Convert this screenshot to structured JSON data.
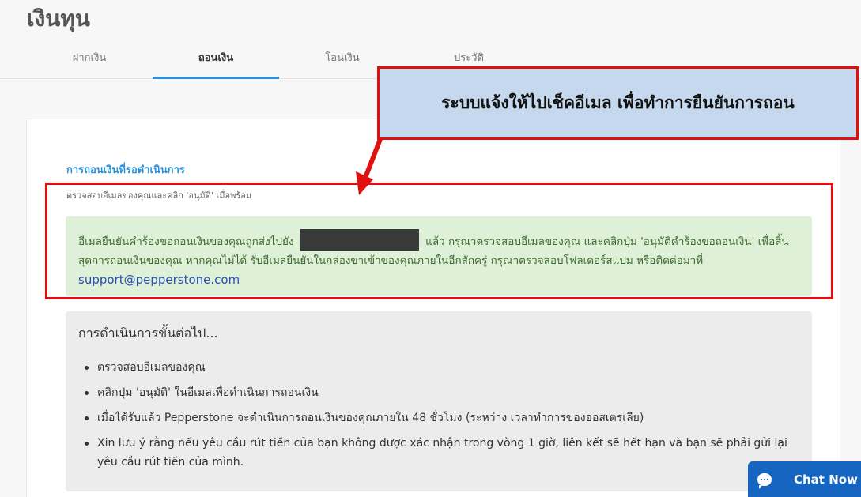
{
  "page": {
    "title": "เงินทุน"
  },
  "tabs": [
    {
      "label": "ฝากเงิน",
      "active": false
    },
    {
      "label": "ถอนเงิน",
      "active": true
    },
    {
      "label": "โอนเงิน",
      "active": false
    },
    {
      "label": "ประวัติ",
      "active": false
    }
  ],
  "pending": {
    "title": "การถอนเงินที่รอดำเนินการ",
    "subtitle": "ตรวจสอบอีเมลของคุณและคลิก 'อนุมัติ' เมื่อพร้อม"
  },
  "alert": {
    "text_before": "อีเมลยืนยันคำร้องขอถอนเงินของคุณถูกส่งไปยัง",
    "text_after": "แล้ว กรุณาตรวจสอบอีเมลของคุณ และคลิกปุ่ม 'อนุมัติคำร้องขอถอนเงิน' เพื่อสิ้นสุดการถอนเงินของคุณ หากคุณไม่ได้ รับอีเมลยืนยันในกล่องขาเข้าของคุณภายในอีกสักครู่ กรุณาตรวจสอบโฟลเดอร์สแปม หรือติดต่อมาที่",
    "email": "support@pepperstone.com"
  },
  "next_steps": {
    "title": "การดำเนินการขั้นต่อไป...",
    "items": [
      "ตรวจสอบอีเมลของคุณ",
      "คลิกปุ่ม 'อนุมัติ' ในอีเมลเพื่อดำเนินการถอนเงิน",
      "เมื่อได้รับแล้ว Pepperstone จะดำเนินการถอนเงินของคุณภายใน 48 ชั่วโมง (ระหว่าง เวลาทำการของออสเตรเลีย)",
      "Xin lưu ý rằng nếu yêu cầu rút tiền của bạn không được xác nhận trong vòng 1 giờ, liên kết sẽ hết hạn và bạn sẽ phải gửi lại yêu cầu rút tiền của mình."
    ]
  },
  "annotation": {
    "text": "ระบบแจ้งให้ไปเช็คอีเมล เพื่อทำการยืนยันการถอน"
  },
  "chat": {
    "label": "Chat Now"
  },
  "colors": {
    "accent": "#2d8fd5",
    "annotation_red": "#e01010",
    "chat_blue": "#1565c0",
    "success_bg": "#dff0d8"
  }
}
